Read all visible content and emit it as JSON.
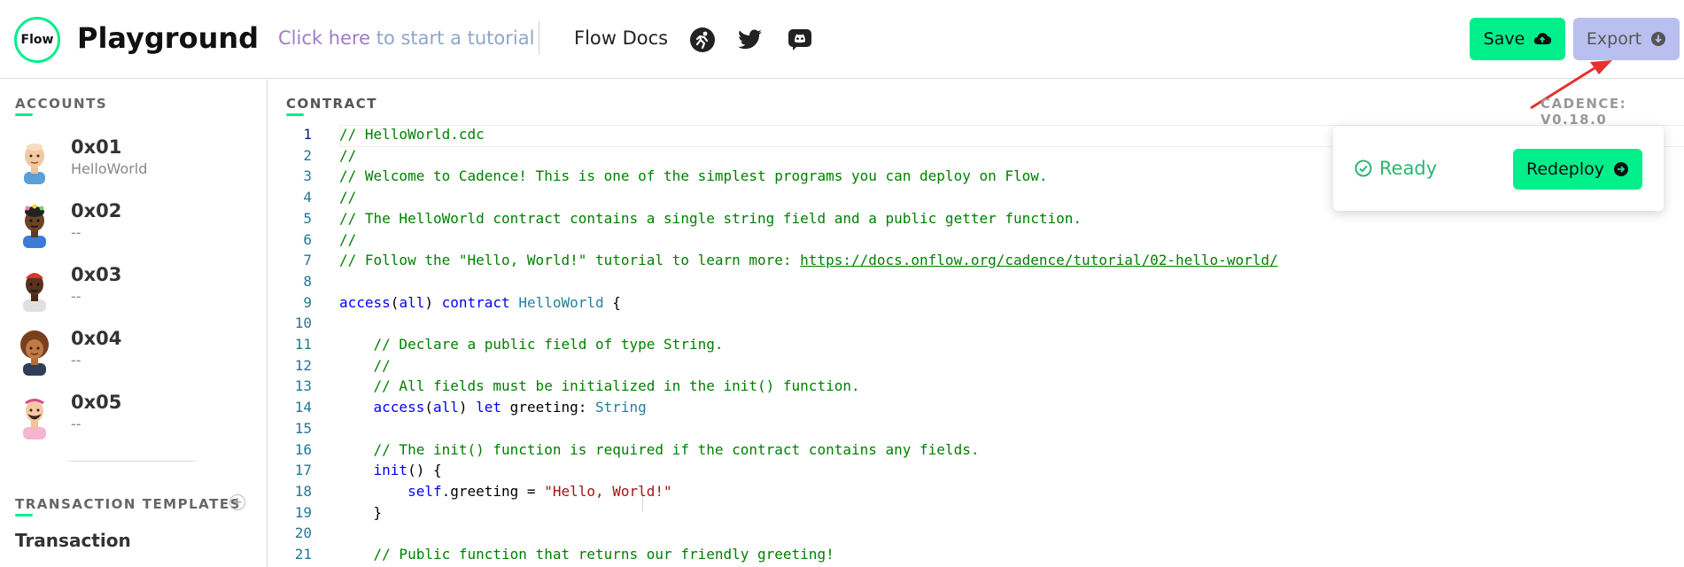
{
  "header": {
    "logo_text": "Flow",
    "title": "Playground",
    "tutorial_link_part1": "Click here",
    "tutorial_link_part2": " to start a tutorial",
    "docs_link": "Flow Docs",
    "icons": [
      "flow-runner-icon",
      "twitter-icon",
      "discord-icon"
    ],
    "save_label": "Save",
    "export_label": "Export"
  },
  "sidebar": {
    "accounts_title": "ACCOUNTS",
    "accounts": [
      {
        "address": "0x01",
        "name": "HelloWorld"
      },
      {
        "address": "0x02",
        "name": "--"
      },
      {
        "address": "0x03",
        "name": "--"
      },
      {
        "address": "0x04",
        "name": "--"
      },
      {
        "address": "0x05",
        "name": "--"
      }
    ],
    "tx_templates_title": "TRANSACTION TEMPLATES",
    "tx_item": "Transaction"
  },
  "editor": {
    "label": "CONTRACT",
    "version": "CADENCE: V0.18.0",
    "active_line": 1,
    "lines": [
      {
        "n": "1",
        "tokens": [
          [
            "c-comment",
            "// HelloWorld.cdc"
          ]
        ]
      },
      {
        "n": "2",
        "tokens": [
          [
            "c-comment",
            "//"
          ]
        ]
      },
      {
        "n": "3",
        "tokens": [
          [
            "c-comment",
            "// Welcome to Cadence! This is one of the simplest programs you can deploy on Flow."
          ]
        ]
      },
      {
        "n": "4",
        "tokens": [
          [
            "c-comment",
            "//"
          ]
        ]
      },
      {
        "n": "5",
        "tokens": [
          [
            "c-comment",
            "// The HelloWorld contract contains a single string field and a public getter function."
          ]
        ]
      },
      {
        "n": "6",
        "tokens": [
          [
            "c-comment",
            "//"
          ]
        ]
      },
      {
        "n": "7",
        "tokens": [
          [
            "c-comment",
            "// Follow the \"Hello, World!\" tutorial to learn more: "
          ],
          [
            "c-url",
            "https://docs.onflow.org/cadence/tutorial/02-hello-world/"
          ]
        ]
      },
      {
        "n": "8",
        "tokens": []
      },
      {
        "n": "9",
        "tokens": [
          [
            "c-kw",
            "access"
          ],
          [
            "c-plain",
            "("
          ],
          [
            "c-kw",
            "all"
          ],
          [
            "c-plain",
            ") "
          ],
          [
            "c-kw",
            "contract"
          ],
          [
            "c-plain",
            " "
          ],
          [
            "c-type",
            "HelloWorld"
          ],
          [
            "c-plain",
            " {"
          ]
        ]
      },
      {
        "n": "10",
        "tokens": []
      },
      {
        "n": "11",
        "tokens": [
          [
            "c-plain",
            "    "
          ],
          [
            "c-comment",
            "// Declare a public field of type String."
          ]
        ]
      },
      {
        "n": "12",
        "tokens": [
          [
            "c-plain",
            "    "
          ],
          [
            "c-comment",
            "//"
          ]
        ]
      },
      {
        "n": "13",
        "tokens": [
          [
            "c-plain",
            "    "
          ],
          [
            "c-comment",
            "// All fields must be initialized in the init() function."
          ]
        ]
      },
      {
        "n": "14",
        "tokens": [
          [
            "c-plain",
            "    "
          ],
          [
            "c-kw",
            "access"
          ],
          [
            "c-plain",
            "("
          ],
          [
            "c-kw",
            "all"
          ],
          [
            "c-plain",
            ") "
          ],
          [
            "c-kw",
            "let"
          ],
          [
            "c-plain",
            " greeting: "
          ],
          [
            "c-type",
            "String"
          ]
        ]
      },
      {
        "n": "15",
        "tokens": []
      },
      {
        "n": "16",
        "tokens": [
          [
            "c-plain",
            "    "
          ],
          [
            "c-comment",
            "// The init() function is required if the contract contains any fields."
          ]
        ]
      },
      {
        "n": "17",
        "tokens": [
          [
            "c-plain",
            "    "
          ],
          [
            "c-kw",
            "init"
          ],
          [
            "c-plain",
            "() {"
          ]
        ]
      },
      {
        "n": "18",
        "tokens": [
          [
            "c-plain",
            "        "
          ],
          [
            "c-kw",
            "self"
          ],
          [
            "c-plain",
            ".greeting = "
          ],
          [
            "c-str",
            "\"Hello, World!\""
          ]
        ]
      },
      {
        "n": "19",
        "tokens": [
          [
            "c-plain",
            "    }"
          ]
        ]
      },
      {
        "n": "20",
        "tokens": []
      },
      {
        "n": "21",
        "tokens": [
          [
            "c-plain",
            "    "
          ],
          [
            "c-comment",
            "// Public function that returns our friendly greeting!"
          ]
        ]
      }
    ]
  },
  "deploy": {
    "status": "Ready",
    "redeploy_label": "Redeploy"
  },
  "colors": {
    "accent": "#00ef8b",
    "export_bg": "#b9c0f0",
    "ready": "#2bb673",
    "arrow": "#e5322d"
  }
}
